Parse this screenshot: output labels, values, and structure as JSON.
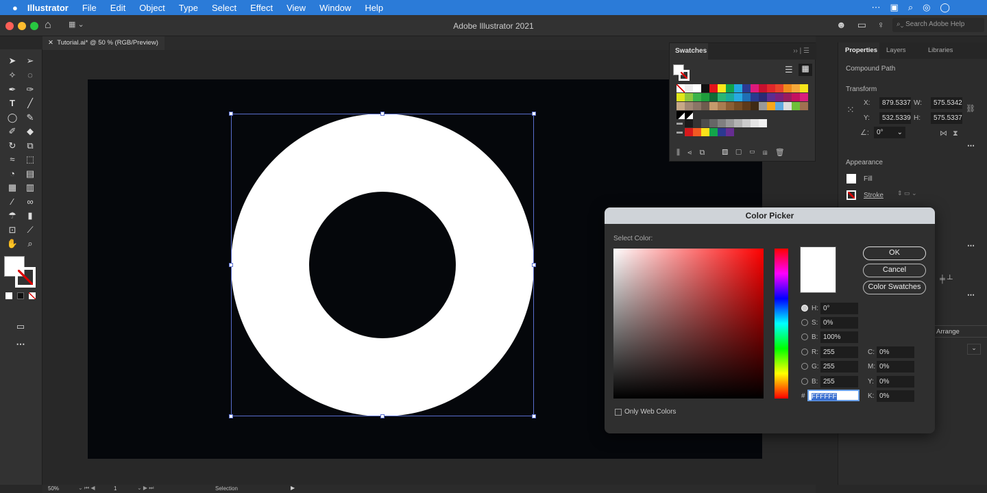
{
  "menubar": {
    "app": "Illustrator",
    "items": [
      "File",
      "Edit",
      "Object",
      "Type",
      "Select",
      "Effect",
      "View",
      "Window",
      "Help"
    ]
  },
  "titlebar": {
    "title": "Adobe Illustrator 2021",
    "search_placeholder": "Search Adobe Help"
  },
  "document_tab": {
    "label": "Tutorial.ai* @ 50 % (RGB/Preview)"
  },
  "swatches": {
    "title": "Swatches",
    "row1": [
      "#ffffff",
      "#eeeeee",
      "#ffffff",
      "#111111",
      "#e3141b",
      "#fbe71a",
      "#12a24a",
      "#22a7e0",
      "#2b3992",
      "#de1a7c",
      "#c8102e",
      "#e0282a",
      "#e8442a",
      "#f08a1c",
      "#f6a93a",
      "#f5e51a"
    ],
    "row2": [
      "#e0e61a",
      "#8cc63f",
      "#3bb34a",
      "#1f9e3c",
      "#116b35",
      "#2bb673",
      "#1aa99a",
      "#27a9e1",
      "#1f6fb5",
      "#293a8f",
      "#2b2a74",
      "#5c2d91",
      "#7b1f7a",
      "#9a1b5e",
      "#c4115f",
      "#d81f7b"
    ],
    "row3": [
      "#c7a887",
      "#a08774",
      "#8a7566",
      "#6e5c4e",
      "#c49a6c",
      "#a97c50",
      "#8b5e34",
      "#754c24",
      "#5e3a1a",
      "#3f2a14",
      "#999999",
      "#f7a61c",
      "#5da9e0",
      "#dddddd",
      "#6fbf3a",
      "#a07050"
    ],
    "grays": [
      "#1a1a1a",
      "#333333",
      "#4d4d4d",
      "#666666",
      "#808080",
      "#999999",
      "#b3b3b3",
      "#cccccc",
      "#e6e6e6",
      "#f2f2f2"
    ],
    "group": [
      "#d7191c",
      "#f15a22",
      "#f9e11a",
      "#13a54a",
      "#2b3990",
      "#662d91"
    ]
  },
  "properties": {
    "tabs": [
      "Properties",
      "Layers",
      "Libraries"
    ],
    "object_type": "Compound Path",
    "transform_title": "Transform",
    "x_label": "X:",
    "x": "879.5337",
    "y_label": "Y:",
    "y": "532.5339",
    "w_label": "W:",
    "w": "575.5342",
    "h_label": "H:",
    "h": "575.5337",
    "angle": "0°",
    "appearance_title": "Appearance",
    "fill": "Fill",
    "stroke": "Stroke",
    "arrange": "Arrange"
  },
  "color_picker": {
    "title": "Color Picker",
    "select_label": "Select Color:",
    "ok": "OK",
    "cancel": "Cancel",
    "swatches": "Color Swatches",
    "H_label": "H:",
    "H": "0°",
    "S_label": "S:",
    "S": "0%",
    "B_label": "B:",
    "B": "100%",
    "R_label": "R:",
    "R": "255",
    "G_label": "G:",
    "G": "255",
    "Bl_label": "B:",
    "Bl": "255",
    "C_label": "C:",
    "C": "0%",
    "M_label": "M:",
    "M": "0%",
    "Y_label": "Y:",
    "Y": "0%",
    "K_label": "K:",
    "K": "0%",
    "hash": "#",
    "hex": "FFFFFF",
    "web_only": "Only Web Colors"
  },
  "status": {
    "zoom": "50%",
    "artboard": "1",
    "tool": "Selection"
  }
}
